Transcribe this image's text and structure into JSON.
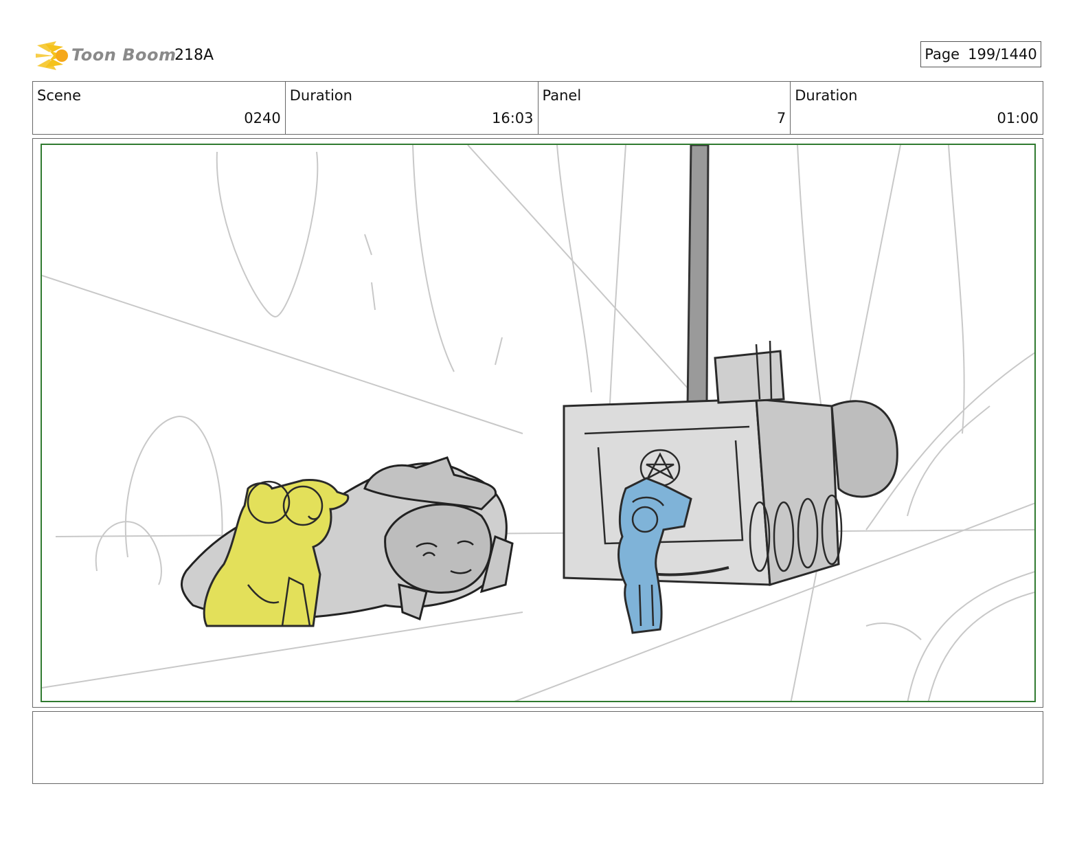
{
  "header": {
    "logo_text": "Toon Boom",
    "production_code": "218A",
    "page_label": "Page",
    "page_value": "199/1440"
  },
  "info": {
    "scene_label": "Scene",
    "scene_value": "0240",
    "scene_duration_label": "Duration",
    "scene_duration_value": "16:03",
    "panel_label": "Panel",
    "panel_value": "7",
    "panel_duration_label": "Duration",
    "panel_duration_value": "01:00"
  },
  "colors": {
    "safe_frame": "#2f7a2f",
    "yellow_character": "#e3e05a",
    "blue_character": "#7fb3d8",
    "logo_burst": "#f5c21b"
  },
  "notes": {
    "text": ""
  }
}
